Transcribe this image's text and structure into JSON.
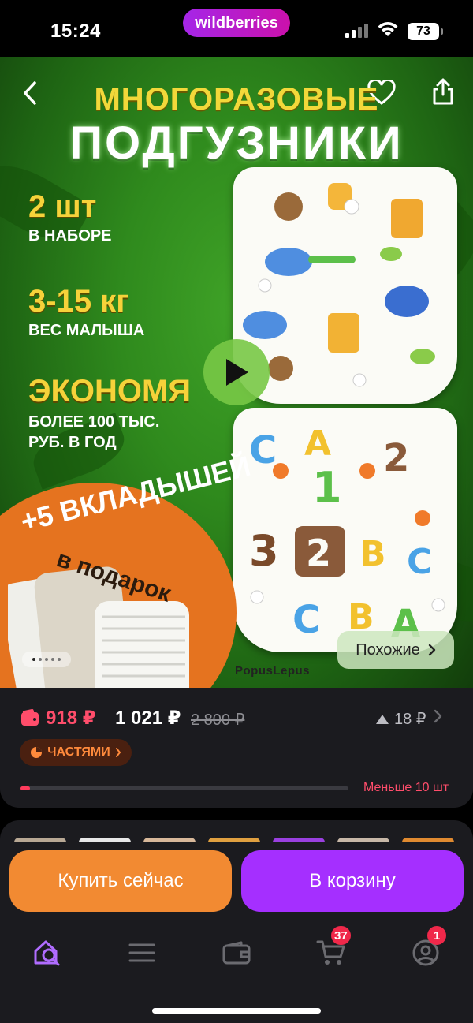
{
  "status_bar": {
    "time": "15:24",
    "brand": "wildberries",
    "battery": "73"
  },
  "hero": {
    "title_line1": "МНОГОРАЗОВЫЕ",
    "title_line2": "ПОДГУЗНИКИ",
    "stats": [
      {
        "big": "2 шт",
        "small": "В НАБОРЕ"
      },
      {
        "big": "3-15 кг",
        "small": "ВЕС МАЛЫША"
      },
      {
        "big": "ЭКОНОМЯ",
        "small_line1": "БОЛЕЕ 100 ТЫС.",
        "small_line2": "РУБ. В ГОД"
      }
    ],
    "gift_line1": "+5 ВКЛАДЫШЕЙ",
    "gift_line2": "в подарок",
    "similar_button": "Похожие",
    "watermark": "PopusLepus",
    "slide_count": 5,
    "active_slide": 0,
    "colors": {
      "title_yellow": "#f2d83a",
      "bg_green": "#2f8a1d",
      "promo_orange": "#e5731f"
    }
  },
  "price": {
    "wallet_price": "918 ₽",
    "price": "1 021 ₽",
    "old_price": "2 800 ₽",
    "price_rise": "18 ₽",
    "installments_label": "ЧАСТЯМИ",
    "stock_label": "Меньше 10 шт",
    "stock_fraction": 0.03,
    "colors": {
      "wallet": "#ff4d6b",
      "installments": "#ff8a3c"
    }
  },
  "actions": {
    "buy_now": "Купить сейчас",
    "add_to_cart": "В корзину",
    "colors": {
      "buy": "#f28a32",
      "cart": "#a52fff"
    }
  },
  "tab_bar": {
    "items": [
      {
        "icon": "home-search-icon",
        "active": true
      },
      {
        "icon": "menu-icon"
      },
      {
        "icon": "wallet-icon"
      },
      {
        "icon": "cart-icon",
        "badge": "37"
      },
      {
        "icon": "profile-icon",
        "badge": "1"
      }
    ],
    "active_color": "#b06cff"
  }
}
